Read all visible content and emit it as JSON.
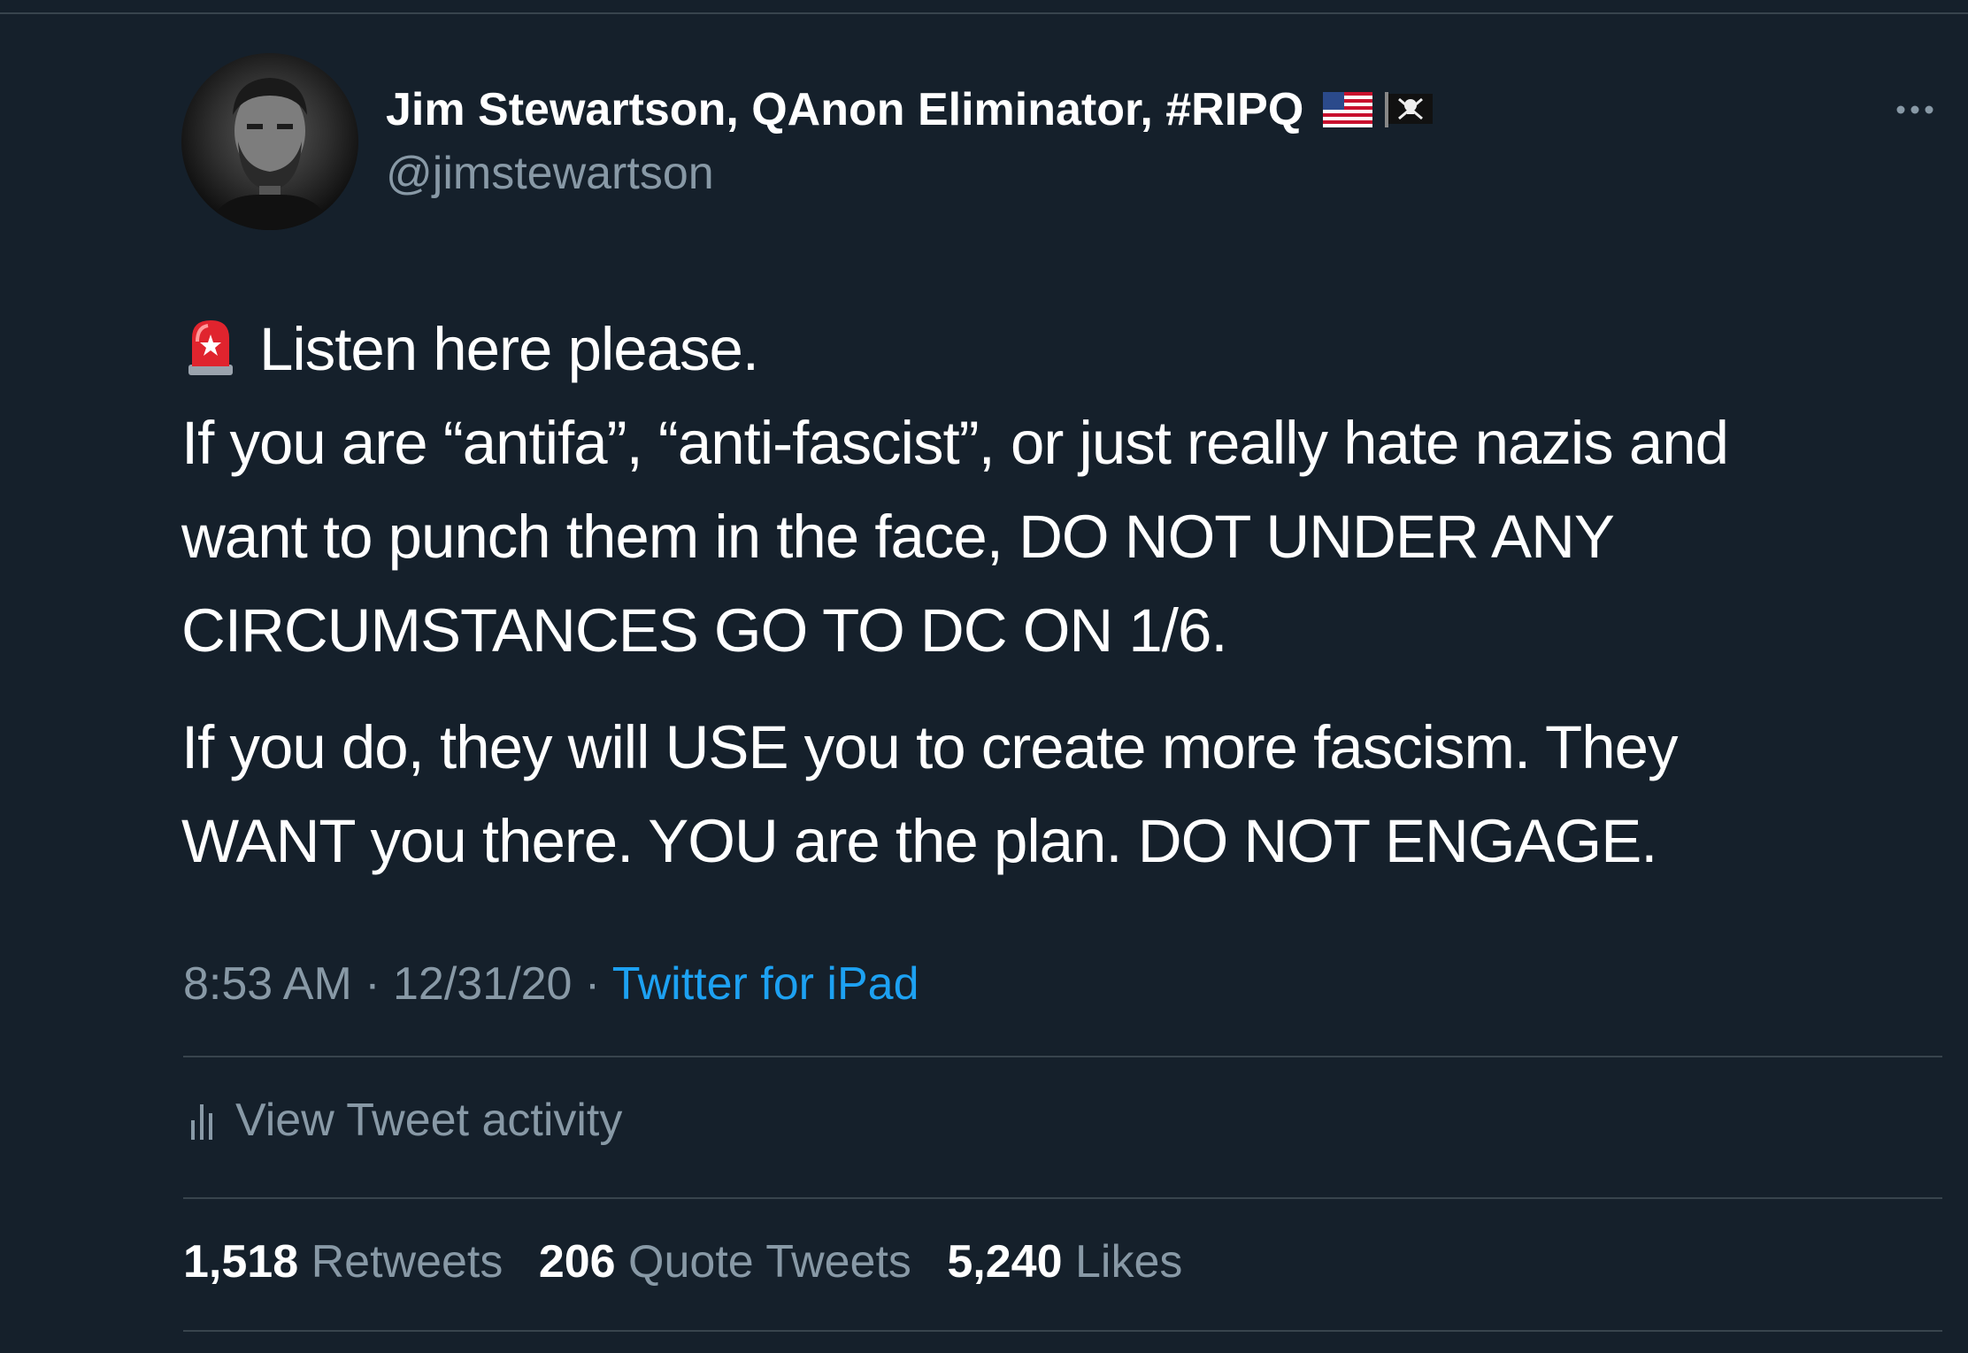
{
  "author": {
    "display_name": "Jim Stewartson, QAnon Eliminator, #RIPQ",
    "handle": "@jimstewartson",
    "flag_icons": [
      "us-flag-icon",
      "pirate-flag-icon"
    ]
  },
  "tweet": {
    "lead_icon": "police-siren-icon",
    "line1": "Listen here please.",
    "para1_lines": [
      "If you are “antifa”, “anti-fascist”, or just really hate nazis and",
      "want to punch them in the face, DO NOT UNDER ANY",
      "CIRCUMSTANCES GO TO DC ON 1/6."
    ],
    "para2_lines": [
      "If you do, they will USE you to create more fascism. They",
      "WANT you there. YOU are the plan. DO NOT ENGAGE."
    ],
    "time": "8:53 AM",
    "date": "12/31/20",
    "source": "Twitter for iPad"
  },
  "activity": {
    "label": "View Tweet activity"
  },
  "stats": {
    "retweets_count": "1,518",
    "retweets_label": "Retweets",
    "quotes_count": "206",
    "quotes_label": "Quote Tweets",
    "likes_count": "5,240",
    "likes_label": "Likes"
  },
  "colors": {
    "background": "#15202b",
    "divider": "#38444d",
    "secondary_text": "#8899a6",
    "link": "#1da1f2"
  }
}
